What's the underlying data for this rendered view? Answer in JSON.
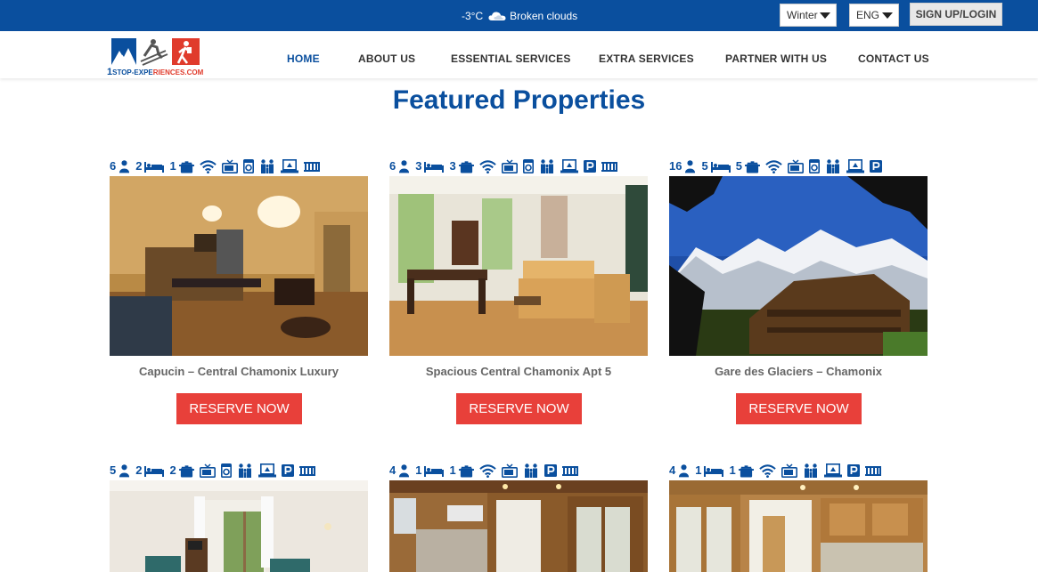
{
  "topbar": {
    "temperature": "-3°C",
    "weather": "Broken clouds",
    "weather_icon": "cloud-icon",
    "season": "Winter",
    "language": "ENG",
    "signup_label": "SIGN UP/LOGIN"
  },
  "brand": {
    "logo_number": "1",
    "logo_text_a": "STOP-EXPE",
    "logo_text_b": "RIENCES.COM",
    "colors": {
      "primary": "#0a4f9e",
      "accent": "#e8403a",
      "logo_red": "#e03b2c"
    }
  },
  "nav": {
    "items": [
      {
        "label": "HOME"
      },
      {
        "label": "ABOUT US"
      },
      {
        "label": "ESSENTIAL SERVICES"
      },
      {
        "label": "EXTRA SERVICES"
      },
      {
        "label": "PARTNER WITH US"
      },
      {
        "label": "CONTACT US"
      }
    ]
  },
  "main": {
    "title": "Featured Properties",
    "reserve_label": "RESERVE NOW",
    "properties": [
      {
        "title": "Capucin – Central Chamonix Luxury",
        "guests": "6",
        "bedrooms": "2",
        "bathrooms": "1",
        "amenities": [
          "pot-icon",
          "wifi-icon",
          "tv-icon",
          "washer-icon",
          "family-icon",
          "laptop-icon",
          "radiator-icon"
        ]
      },
      {
        "title": "Spacious Central Chamonix Apt 5",
        "guests": "6",
        "bedrooms": "3",
        "bathrooms": "3",
        "amenities": [
          "pot-icon",
          "wifi-icon",
          "tv-icon",
          "washer-icon",
          "family-icon",
          "laptop-icon",
          "parking-icon",
          "radiator-icon"
        ]
      },
      {
        "title": "Gare des Glaciers – Chamonix",
        "guests": "16",
        "bedrooms": "5",
        "bathrooms": "5",
        "amenities": [
          "pot-icon",
          "wifi-icon",
          "tv-icon",
          "washer-icon",
          "family-icon",
          "laptop-icon",
          "parking-icon"
        ]
      },
      {
        "title": "",
        "guests": "5",
        "bedrooms": "2",
        "bathrooms": "2",
        "amenities": [
          "pot-icon",
          "tv-icon",
          "washer-icon",
          "family-icon",
          "laptop-icon",
          "parking-icon",
          "radiator-icon"
        ]
      },
      {
        "title": "",
        "guests": "4",
        "bedrooms": "1",
        "bathrooms": "1",
        "amenities": [
          "pot-icon",
          "wifi-icon",
          "tv-icon",
          "family-icon",
          "parking-icon",
          "radiator-icon"
        ]
      },
      {
        "title": "",
        "guests": "4",
        "bedrooms": "1",
        "bathrooms": "1",
        "amenities": [
          "pot-icon",
          "wifi-icon",
          "tv-icon",
          "family-icon",
          "laptop-icon",
          "parking-icon",
          "radiator-icon"
        ]
      }
    ]
  }
}
